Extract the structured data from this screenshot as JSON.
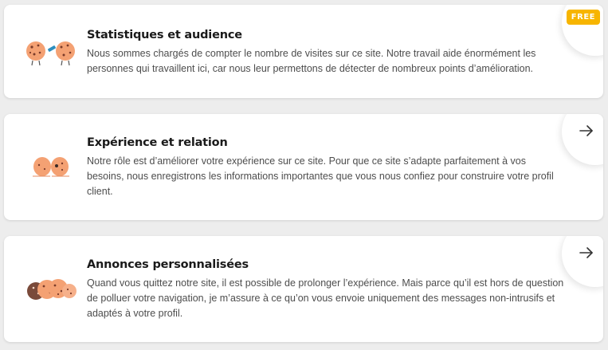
{
  "cards": [
    {
      "title": "Statistiques et audience",
      "description": "Nous sommes chargés de compter le nombre de visites sur ce site. Notre travail aide énormément les personnes qui travaillent ici, car nous leur permettons de détecter de nombreux points d’amélioration.",
      "badge": "FREE",
      "icon": "cookie-pair-telescope-icon"
    },
    {
      "title": "Expérience et relation",
      "description": "Notre rôle est d’améliorer votre expérience sur ce site. Pour que ce site s’adapte parfaitement à vos besoins, nous enregistrons les informations importantes que vous nous confiez pour construire votre profil client.",
      "action": "arrow-right-icon",
      "icon": "cookie-pair-icon"
    },
    {
      "title": "Annonces personnalisées",
      "description": "Quand vous quittez notre site, il est possible de prolonger l’expérience. Mais parce qu’il est hors de question de polluer votre navigation, je m’assure à ce qu’on vous envoie uniquement des messages non-intrusifs et adaptés à votre profil.",
      "action": "arrow-right-icon",
      "icon": "cookie-group-icon"
    }
  ],
  "colors": {
    "background": "#ededed",
    "card": "#ffffff",
    "badge": "#f7b500",
    "cookie": "#f4a173",
    "cookie_dark": "#7a4a3a",
    "title": "#1a1a1a",
    "text": "#4d4d4d"
  }
}
